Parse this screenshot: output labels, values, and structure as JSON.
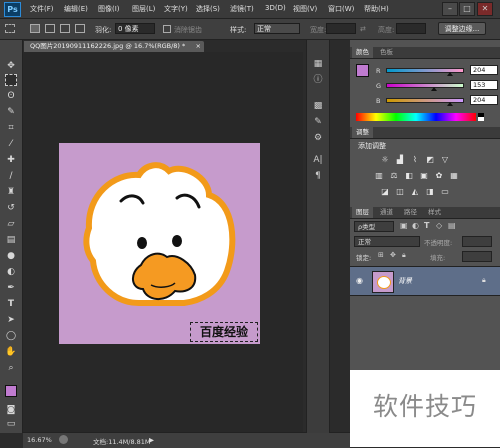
{
  "app": {
    "logo": "Ps"
  },
  "menu": [
    "文件(F)",
    "编辑(E)",
    "图像(I)",
    "图层(L)",
    "文字(Y)",
    "选择(S)",
    "滤镜(T)",
    "3D(D)",
    "视图(V)",
    "窗口(W)",
    "帮助(H)"
  ],
  "window_controls": {
    "minimize": "–",
    "restore": "□",
    "close": "✕"
  },
  "options": {
    "feather_label": "羽化:",
    "feather_value": "0 像素",
    "antialias_label": "消除锯齿",
    "style_label": "样式:",
    "style_value": "正常",
    "width_label": "宽度:",
    "height_label": "高度:",
    "refine_edge": "调整边缘..."
  },
  "document": {
    "tab_title": "QQ图片20190911162226.jpg @ 16.7%(RGB/8) *",
    "close": "×",
    "watermark_text": "百度经验",
    "colors": {
      "canvas": "#c69bcc",
      "outline": "#f29a1a",
      "beak": "#f59a22"
    }
  },
  "status": {
    "zoom": "16.67%",
    "doc_size": "文档:11.4M/8.81M"
  },
  "foreground_color": "#c07bd0",
  "background_color": "#d83ac4",
  "color_panel": {
    "tabs": [
      "颜色",
      "色板"
    ],
    "r_label": "R",
    "g_label": "G",
    "b_label": "B",
    "r": "204",
    "g": "153",
    "b": "204"
  },
  "adjustments": {
    "tab": "调整",
    "title": "添加调整"
  },
  "layers_panel": {
    "tabs": [
      "图层",
      "通道",
      "路径",
      "样式"
    ],
    "filter": "ρ类型",
    "blend_mode": "正常",
    "opacity_label": "不透明度:",
    "lock_label": "锁定:",
    "fill_label": "填充:",
    "layer_name": "背景"
  },
  "overlay": {
    "text": "软件技巧"
  }
}
